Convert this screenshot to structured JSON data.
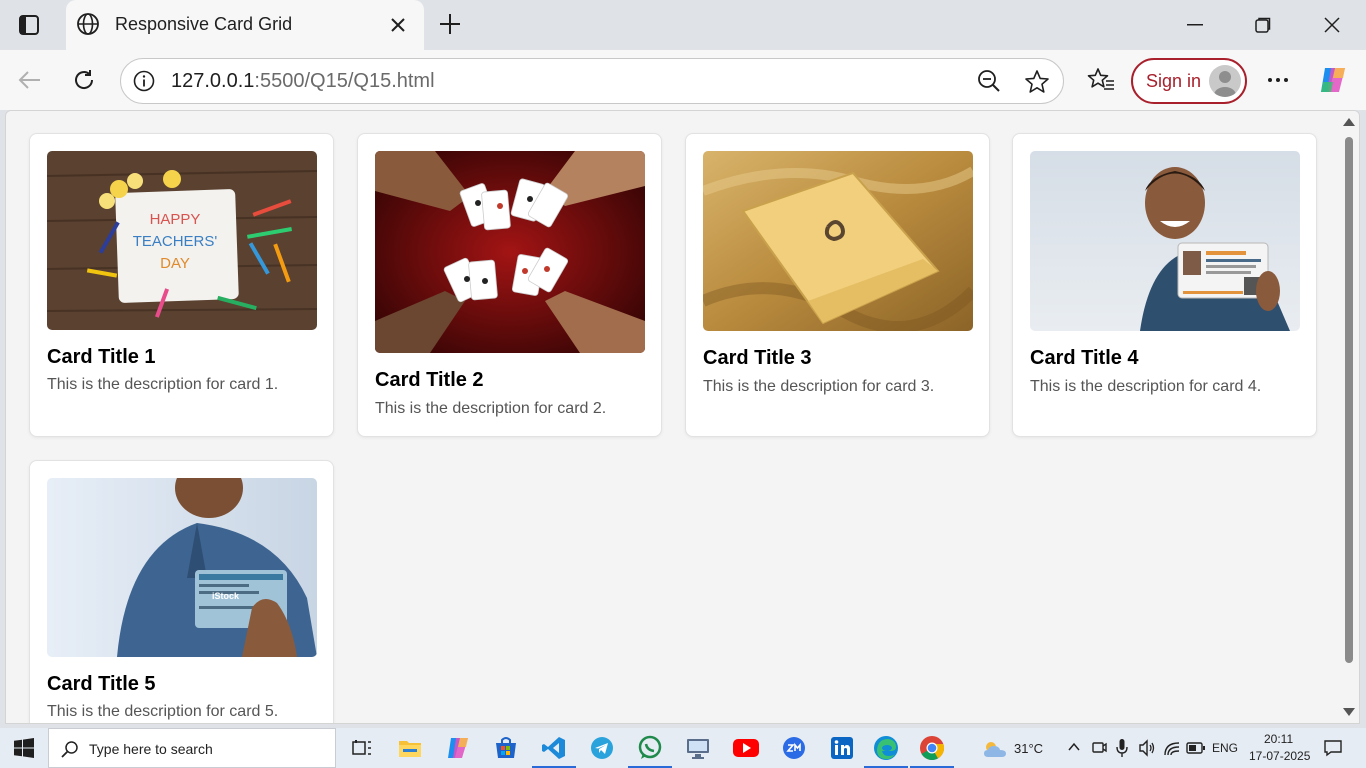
{
  "browser": {
    "tab_title": "Responsive Card Grid",
    "url_host": "127.0.0.1",
    "url_rest": ":5500/Q15/Q15.html",
    "signin_label": "Sign in"
  },
  "cards": [
    {
      "title": "Card Title 1",
      "description": "This is the description for card 1."
    },
    {
      "title": "Card Title 2",
      "description": "This is the description for card 2."
    },
    {
      "title": "Card Title 3",
      "description": "This is the description for card 3."
    },
    {
      "title": "Card Title 4",
      "description": "This is the description for card 4."
    },
    {
      "title": "Card Title 5",
      "description": "This is the description for card 5."
    }
  ],
  "card_images": {
    "card1": {
      "line1": "HAPPY",
      "line2": "TEACHERS'",
      "line3": "DAY"
    },
    "card5": {
      "watermark": "iStock"
    }
  },
  "taskbar": {
    "search_placeholder": "Type here to search",
    "weather": "31°C",
    "language": "ENG",
    "time": "20:11",
    "date": "17-07-2025",
    "apps": [
      "task-view-icon",
      "file-explorer-icon",
      "copilot-icon",
      "microsoft-store-icon",
      "vscode-icon",
      "telegram-icon",
      "whatsapp-icon",
      "remote-desktop-icon",
      "youtube-icon",
      "zoom-icon",
      "linkedin-icon",
      "edge-icon",
      "chrome-icon"
    ]
  },
  "colors": {
    "accent_signin": "#a8202c",
    "taskbar_underline": "#2a6ad8"
  }
}
